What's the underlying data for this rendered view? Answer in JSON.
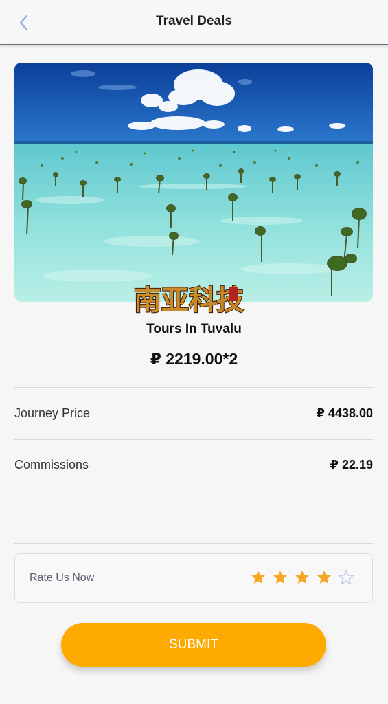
{
  "header": {
    "title": "Travel Deals",
    "back_icon": "chevron-left-icon"
  },
  "hero": {
    "image": "tropical-lagoon-mangrove-sprouts",
    "logo_text": "南亚科技"
  },
  "tour": {
    "name": "Tours In Tuvalu",
    "unit_price": "₽ 2219.00*2"
  },
  "summary": [
    {
      "label": "Journey Price",
      "value": "₽ 4438.00"
    },
    {
      "label": "Commissions",
      "value": "₽ 22.19"
    }
  ],
  "rating": {
    "label": "Rate Us Now",
    "value": 4,
    "max": 5,
    "filled_color": "#f5a623",
    "empty_color": "#b9c6e6"
  },
  "submit_label": "SUBMIT",
  "colors": {
    "accent": "#ffaa00",
    "back_icon": "#8fa6e0"
  }
}
